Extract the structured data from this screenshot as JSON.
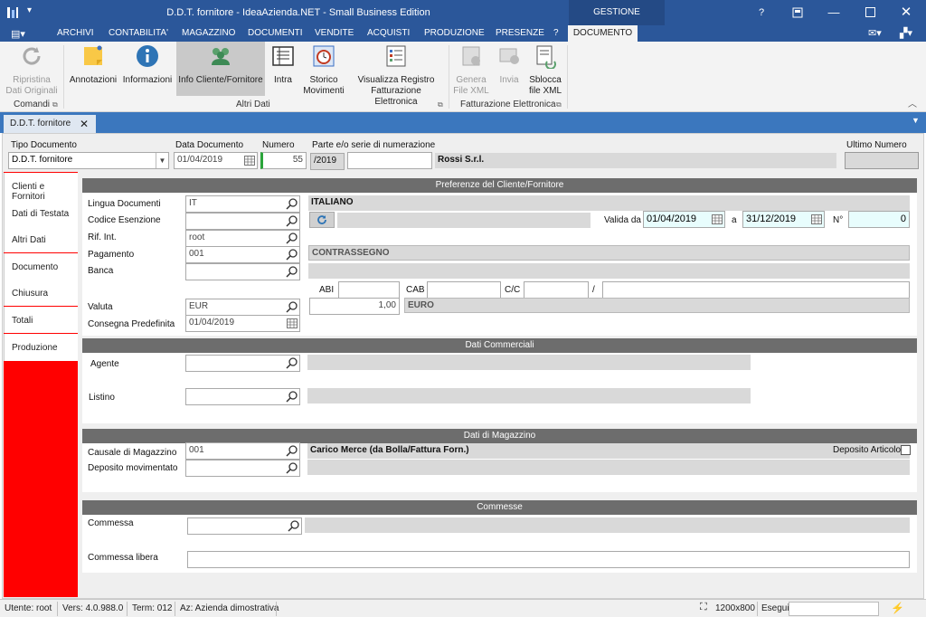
{
  "window": {
    "title": "D.D.T. fornitore - IdeaAzienda.NET - Small Business Edition",
    "contextual_tab": "GESTIONE DOCUMENTI"
  },
  "menu": [
    "ARCHIVI",
    "CONTABILITA'",
    "MAGAZZINO",
    "DOCUMENTI",
    "VENDITE",
    "ACQUISTI",
    "PRODUZIONE",
    "PRESENZE",
    "?"
  ],
  "menu_active": "DOCUMENTO",
  "ribbon": {
    "ripristina": "Ripristina\nDati Originali",
    "comandi": "Comandi",
    "annotazioni": "Annotazioni",
    "informazioni": "Informazioni",
    "info_cliente": "Info Cliente/Fornitore",
    "intra": "Intra",
    "storico": "Storico\nMovimenti",
    "visualizza": "Visualizza Registro\nFatturazione Elettronica",
    "altri_dati": "Altri Dati",
    "genera": "Genera\nFile XML",
    "invia": "Invia",
    "sblocca": "Sblocca\nfile XML",
    "fatturazione": "Fatturazione Elettronica"
  },
  "doc_tab": "D.D.T. fornitore",
  "header": {
    "tipo_label": "Tipo Documento",
    "tipo_value": "D.D.T. fornitore",
    "data_label": "Data Documento",
    "data_value": "01/04/2019",
    "numero_label": "Numero",
    "numero_value": "55",
    "serie_label": "Parte e/o serie di numerazione",
    "serie_value": "/2019",
    "fornitore": "Rossi S.r.l.",
    "ultimo_label": "Ultimo Numero"
  },
  "nav": [
    "Clienti e Fornitori",
    "Dati di Testata",
    "Altri Dati",
    "Documento",
    "Chiusura",
    "Totali",
    "Produzione"
  ],
  "preferenze": {
    "title": "Preferenze del Cliente/Fornitore",
    "lingua_label": "Lingua Documenti",
    "lingua_value": "IT",
    "lingua_desc": "ITALIANO",
    "esenzione_label": "Codice Esenzione",
    "rif_label": "Rif. Int.",
    "rif_value": "root",
    "pagamento_label": "Pagamento",
    "pagamento_value": "001",
    "pagamento_desc": "CONTRASSEGNO",
    "banca_label": "Banca",
    "valida_label": "Valida da",
    "valida_da": "01/04/2019",
    "a_label": "a",
    "valida_a": "31/12/2019",
    "n_label": "N°",
    "n_value": "0",
    "abi_label": "ABI",
    "cab_label": "CAB",
    "cc_label": "C/C",
    "slash": "/",
    "valuta_label": "Valuta",
    "valuta_value": "EUR",
    "cambio_value": "1,00",
    "valuta_desc": "EURO",
    "consegna_label": "Consegna Predefinita",
    "consegna_value": "01/04/2019"
  },
  "commerciali": {
    "title": "Dati Commerciali",
    "agente_label": "Agente",
    "listino_label": "Listino"
  },
  "magazzino": {
    "title": "Dati di Magazzino",
    "causale_label": "Causale di Magazzino",
    "causale_value": "001",
    "causale_desc": "Carico Merce (da Bolla/Fattura Forn.)",
    "deposito_label": "Deposito movimentato",
    "deposito_articolo_label": "Deposito Articolo"
  },
  "commesse": {
    "title": "Commesse",
    "commessa_label": "Commessa",
    "libera_label": "Commessa libera"
  },
  "status": {
    "utente": "Utente: root",
    "vers": "Vers: 4.0.988.0",
    "term": "Term: 012",
    "az": "Az: Azienda dimostrativa",
    "res": "1200x800",
    "esegui": "Esegui"
  }
}
